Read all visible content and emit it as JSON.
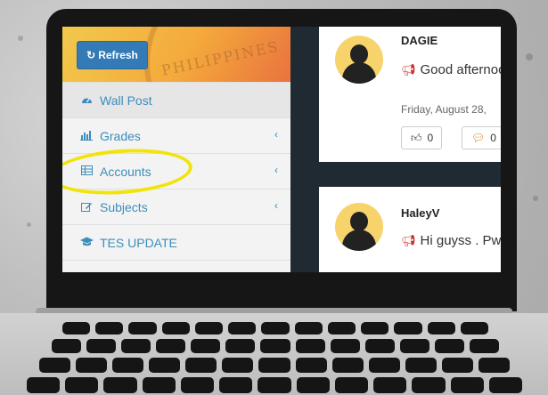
{
  "sidebar": {
    "header_watermark": "PHILIPPINES",
    "refresh_label": "Refresh",
    "items": [
      {
        "label": "Wall Post",
        "icon": "dashboard-icon"
      },
      {
        "label": "Grades",
        "icon": "bar-chart-icon"
      },
      {
        "label": "Accounts",
        "icon": "table-icon"
      },
      {
        "label": "Subjects",
        "icon": "edit-icon"
      },
      {
        "label": "TES UPDATE",
        "icon": "graduation-cap-icon"
      }
    ]
  },
  "posts": [
    {
      "username": "DAGIE",
      "message": "Good afternoon",
      "date": "Friday, August 28,",
      "likes": "0",
      "comments": "0"
    },
    {
      "username": "HaleyV",
      "message": "Hi guyss . Pwede"
    }
  ],
  "colors": {
    "accent": "#3c8dbc",
    "button": "#337ab7",
    "highlight": "#f1e40a",
    "megaphone": "#c9302c"
  }
}
